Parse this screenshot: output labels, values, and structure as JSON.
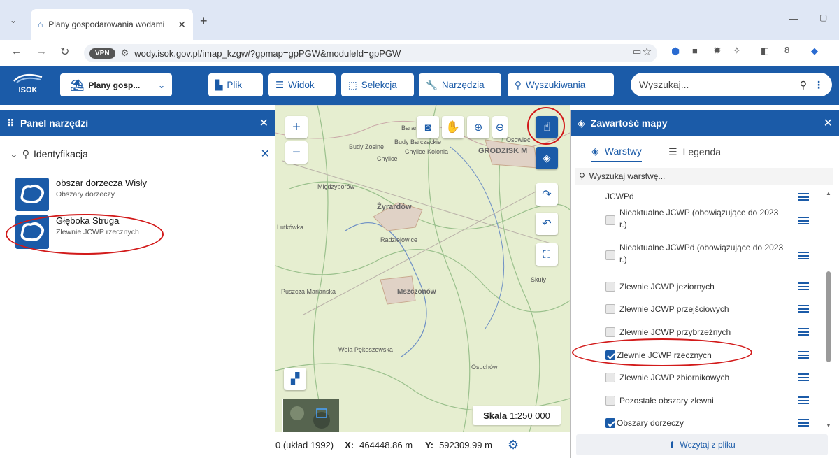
{
  "browser": {
    "tab_title": "Plany gospodarowania wodami",
    "url": "wody.isok.gov.pl/imap_kzgw/?gpmap=gpPGW&moduleId=gpPGW",
    "vpn_label": "VPN"
  },
  "header": {
    "logo_text": "ISOK",
    "module_select": "Plany gosp...",
    "buttons": [
      "Plik",
      "Widok",
      "Selekcja",
      "Narzędzia",
      "Wyszukiwania"
    ],
    "search_placeholder": "Wyszukaj..."
  },
  "left_panel": {
    "title": "Panel narzędzi",
    "section": "Identyfikacja",
    "results": [
      {
        "title": "obszar dorzecza Wisły",
        "subtitle": "Obszary dorzeczy"
      },
      {
        "title": "Głęboka Struga",
        "subtitle": "Zlewnie JCWP rzecznych"
      }
    ]
  },
  "map": {
    "labels": [
      "Baranów",
      "Budy Zosine",
      "Budy Barcząckie",
      "Osowiec",
      "GRODZISK M",
      "Chylice Kolonia",
      "Chylice",
      "Żyrardów",
      "Mszczonów",
      "Wola Pękoszewska",
      "Puszcza Mariańska",
      "Lutkówka",
      "Radziejowice",
      "Skuły",
      "Osuchów",
      "Międzyborów"
    ],
    "scale_label": "Skala",
    "scale_value": "1:250 000",
    "coord_prefix": "0 (układ 1992)",
    "x_label": "X:",
    "x_value": "464448.86 m",
    "y_label": "Y:",
    "y_value": "592309.99 m"
  },
  "right_panel": {
    "title": "Zawartość mapy",
    "tabs": [
      "Warstwy",
      "Legenda"
    ],
    "search_placeholder": "Wyszukaj warstwę...",
    "layers": [
      {
        "label": "JCWPd",
        "checked": false
      },
      {
        "label": "Nieaktualne JCWP (obowiązujące do 2023 r.)",
        "checked": false
      },
      {
        "label": "Nieaktualne JCWPd (obowiązujące do 2023 r.)",
        "checked": false
      },
      {
        "label": "Zlewnie JCWP jeziornych",
        "checked": false
      },
      {
        "label": "Zlewnie JCWP przejściowych",
        "checked": false
      },
      {
        "label": "Zlewnie JCWP przybrzeżnych",
        "checked": false
      },
      {
        "label": "Zlewnie JCWP rzecznych",
        "checked": true
      },
      {
        "label": "Zlewnie JCWP zbiornikowych",
        "checked": false
      },
      {
        "label": "Pozostałe obszary zlewni",
        "checked": false
      },
      {
        "label": "Obszary dorzeczy",
        "checked": true
      }
    ],
    "load_button": "Wczytaj z pliku"
  },
  "colors": {
    "primary": "#1b5ba8",
    "highlight": "#d21a1a"
  }
}
